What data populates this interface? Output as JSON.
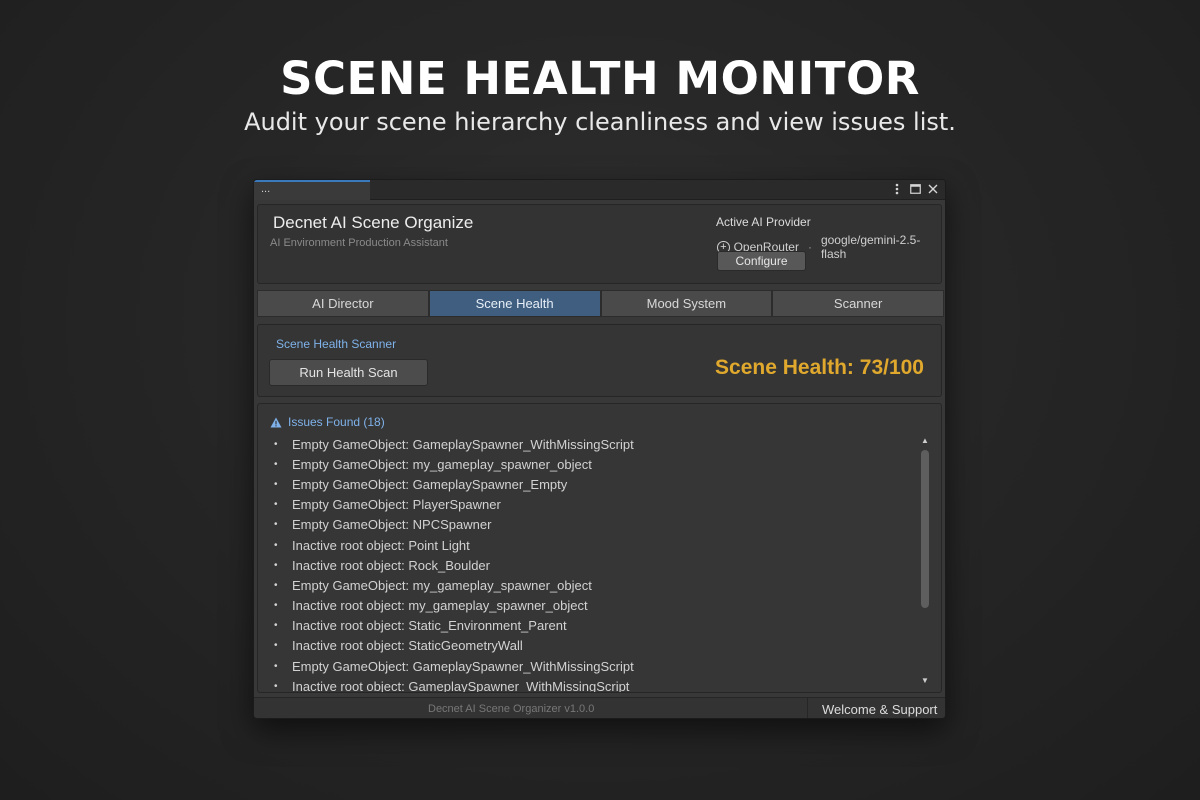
{
  "hero": {
    "title": "SCENE HEALTH MONITOR",
    "subtitle": "Audit your scene hierarchy cleanliness and view issues list."
  },
  "window": {
    "tab_label": "...",
    "title": "Decnet AI Scene Organize",
    "subtitle": "AI Environment Production Assistant",
    "titlebar_icons": [
      "more-icon",
      "maximize-icon",
      "close-icon"
    ]
  },
  "provider": {
    "label": "Active AI Provider",
    "name": "OpenRouter",
    "separator": "·",
    "model": "google/gemini-2.5-flash",
    "configure_label": "Configure"
  },
  "tabs": [
    {
      "label": "AI Director",
      "active": false
    },
    {
      "label": "Scene Health",
      "active": true
    },
    {
      "label": "Mood System",
      "active": false
    },
    {
      "label": "Scanner",
      "active": false
    }
  ],
  "scanner": {
    "label": "Scene Health Scanner",
    "run_button": "Run Health Scan",
    "score_text": "Scene Health:  73/100"
  },
  "issues": {
    "header": "Issues Found (18)",
    "items": [
      "Empty GameObject: GameplaySpawner_WithMissingScript",
      "Empty GameObject: my_gameplay_spawner_object",
      "Empty GameObject: GameplaySpawner_Empty",
      "Empty GameObject: PlayerSpawner",
      "Empty GameObject: NPCSpawner",
      "Inactive root object: Point Light",
      "Inactive root object: Rock_Boulder",
      "Empty GameObject: my_gameplay_spawner_object",
      "Inactive root object: my_gameplay_spawner_object",
      "Inactive root object: Static_Environment_Parent",
      "Inactive root object: StaticGeometryWall",
      "Empty GameObject: GameplaySpawner_WithMissingScript",
      "Inactive root object: GameplaySpawner_WithMissingScript"
    ]
  },
  "footer": {
    "version": "Decnet AI Scene Organizer  v1.0.0",
    "welcome": "Welcome & Support"
  },
  "colors": {
    "accent_blue": "#7fb2ea",
    "active_tab": "#3f5e80",
    "health_score": "#e0a92d"
  }
}
